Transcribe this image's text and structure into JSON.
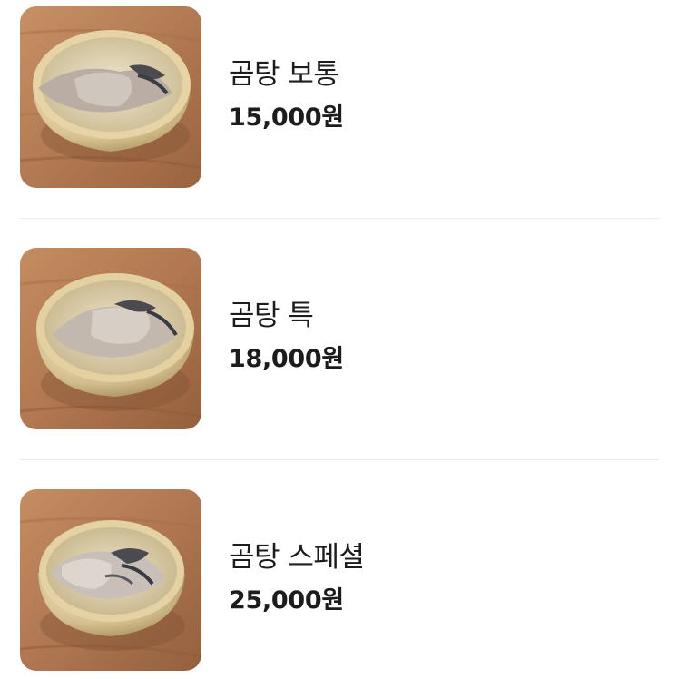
{
  "menu": {
    "items": [
      {
        "name": "곰탕 보통",
        "price": "15,000원",
        "photo_icon": "gomtang-bowl-photo"
      },
      {
        "name": "곰탕 특",
        "price": "18,000원",
        "photo_icon": "gomtang-bowl-photo"
      },
      {
        "name": "곰탕 스페셜",
        "price": "25,000원",
        "photo_icon": "gomtang-bowl-photo"
      }
    ]
  },
  "colors": {
    "text": "#1c1c1c",
    "divider": "#ececec",
    "wood": "#b57a4f",
    "brass": "#d9c59a"
  }
}
